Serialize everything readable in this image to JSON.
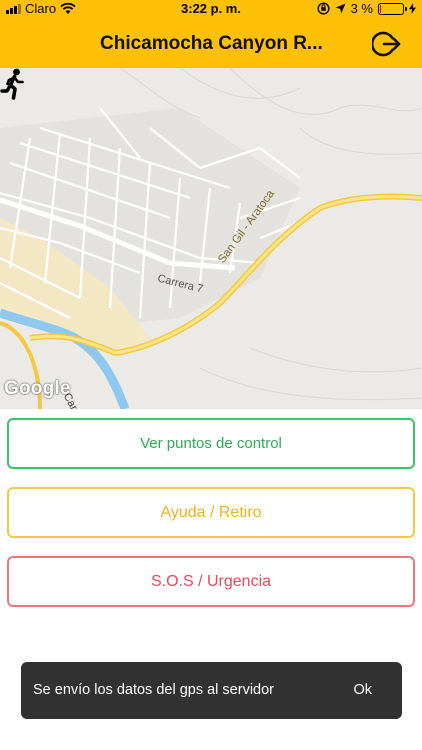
{
  "status_bar": {
    "carrier": "Claro",
    "time": "3:22 p. m.",
    "battery_text": "3 %",
    "battery_level": 0.03
  },
  "header": {
    "title": "Chicamocha Canyon R...",
    "logout_icon": "logout-icon"
  },
  "map": {
    "labels": {
      "carrera7": "Carrera 7",
      "san_gil": "San Gil - Aratoca",
      "carrer": "Carrer"
    },
    "attribution": "Google",
    "marker_icon": "walking-person-icon"
  },
  "actions": {
    "control_points": "Ver puntos de control",
    "help_retire": "Ayuda / Retiro",
    "sos": "S.O.S / Urgencia"
  },
  "snackbar": {
    "message": "Se envío los datos del gps al servidor",
    "action": "Ok"
  },
  "colors": {
    "header": "#FFC107",
    "control_border": "#3cc46a",
    "help_border": "#f1c94a",
    "sos_border": "#f07582",
    "snackbar_bg": "#323232"
  }
}
